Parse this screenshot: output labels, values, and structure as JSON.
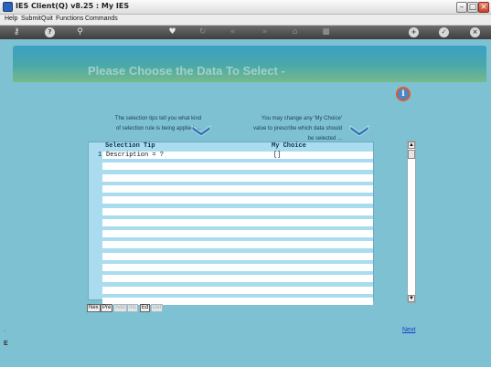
{
  "window": {
    "title": "IES Client(Q) v8.25 : My IES"
  },
  "menu": [
    "Help",
    "Submit",
    "Quit",
    "Functions",
    "Commands"
  ],
  "toolbar": {
    "icons": [
      "key-icon",
      "help-icon",
      "search-icon",
      "heart-icon",
      "refresh-icon",
      "rewind-icon",
      "fast-forward-icon",
      "bin-icon",
      "stop-icon",
      "add-icon",
      "check-icon",
      "close-icon"
    ]
  },
  "page": {
    "title": "Please Choose the Data To Select -",
    "tip_left": [
      "The selection tips tell you what kind",
      "of selection rule is being applied ..."
    ],
    "tip_right": [
      "You may change any 'My Choice'",
      "value to prescribe which data should",
      "be selected ..."
    ]
  },
  "table": {
    "columns": [
      "Selection Tip",
      "My Choice"
    ],
    "rows": [
      {
        "num": "1",
        "tip": "Description = ?",
        "choice": "[]"
      }
    ],
    "empty_rows": 13
  },
  "nav_buttons": [
    {
      "label": "Nex",
      "enabled": true
    },
    {
      "label": "Pre",
      "enabled": true
    },
    {
      "label": "Add",
      "enabled": false
    },
    {
      "label": "Ins",
      "enabled": false
    },
    {
      "label": "Ed",
      "enabled": true
    },
    {
      "label": "Del",
      "enabled": false
    }
  ],
  "next_link": "Next",
  "colors": {
    "background": "#7dc1d2",
    "banner": "#3aa0c4",
    "link": "#1b3cc9"
  }
}
